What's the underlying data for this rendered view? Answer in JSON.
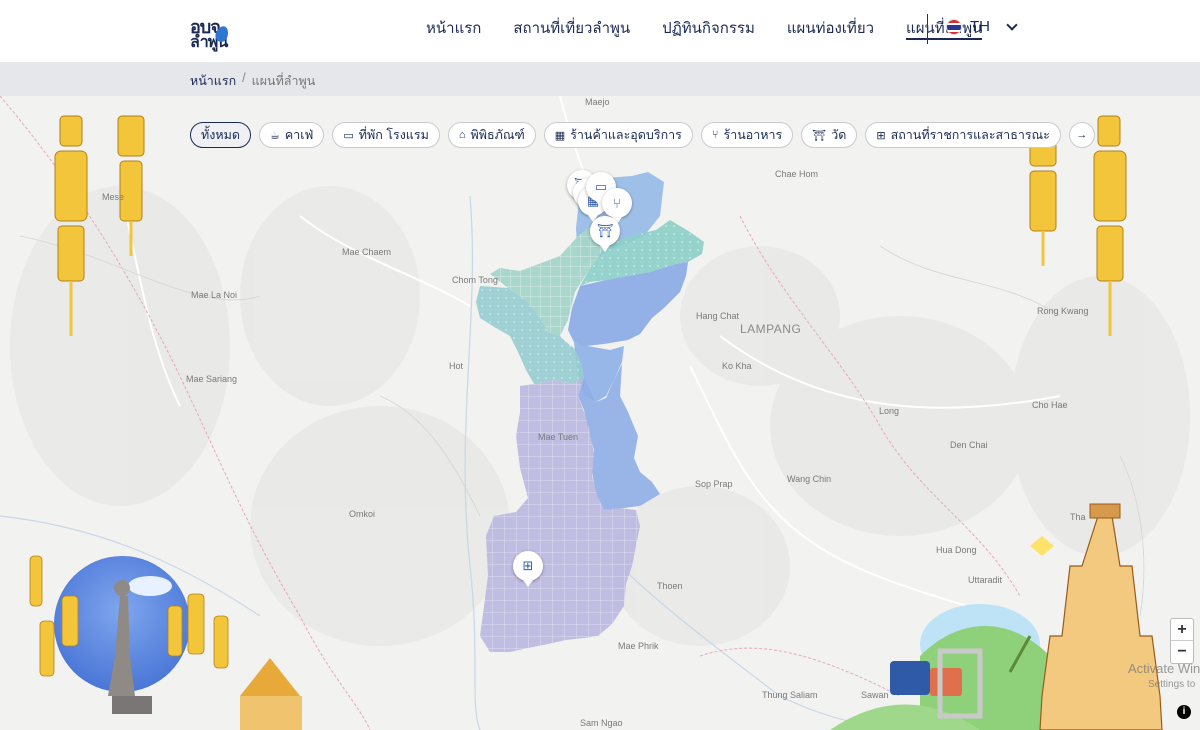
{
  "header": {
    "logo_line1": "อบจ",
    "logo_line2": "ลำพูน",
    "nav": [
      {
        "label": "หน้าแรก"
      },
      {
        "label": "สถานที่เที่ยวลำพูน"
      },
      {
        "label": "ปฏิทินกิจกรรม"
      },
      {
        "label": "แผนท่องเที่ยว"
      },
      {
        "label": "แผนที่ลำพูน",
        "active": true
      }
    ],
    "language": "TH"
  },
  "breadcrumb": {
    "home": "หน้าแรก",
    "separator": "/",
    "current": "แผนที่ลำพูน"
  },
  "filters": [
    {
      "label": "ทั้งหมด",
      "icon": "",
      "active": true
    },
    {
      "label": "คาเฟ่",
      "icon": "cafe-icon"
    },
    {
      "label": "ที่พัก โรงแรม",
      "icon": "bed-icon"
    },
    {
      "label": "พิพิธภัณฑ์",
      "icon": "museum-icon"
    },
    {
      "label": "ร้านค้าและอุดบริการ",
      "icon": "shop-icon"
    },
    {
      "label": "ร้านอาหาร",
      "icon": "utensils-icon"
    },
    {
      "label": "วัด",
      "icon": "temple-icon"
    },
    {
      "label": "สถานที่ราชการและสาธารณะ",
      "icon": "government-icon"
    }
  ],
  "map": {
    "places": [
      {
        "name": "Maejo"
      },
      {
        "name": "Mese"
      },
      {
        "name": "Chae Hom"
      },
      {
        "name": "Mae Chaem"
      },
      {
        "name": "Chom Tong"
      },
      {
        "name": "Mae La Noi"
      },
      {
        "name": "Hang Chat"
      },
      {
        "name": "LAMPANG",
        "big": true
      },
      {
        "name": "Rong Kwang"
      },
      {
        "name": "Hot"
      },
      {
        "name": "Ko Kha"
      },
      {
        "name": "Mae Sariang"
      },
      {
        "name": "Long"
      },
      {
        "name": "Cho Hae"
      },
      {
        "name": "Mae Tuen"
      },
      {
        "name": "Den Chai"
      },
      {
        "name": "Sop Prap"
      },
      {
        "name": "Wang Chin"
      },
      {
        "name": "Omkoi"
      },
      {
        "name": "Tha"
      },
      {
        "name": "Hua Dong"
      },
      {
        "name": "Uttaradit"
      },
      {
        "name": "Thoen"
      },
      {
        "name": "Mae Phrik"
      },
      {
        "name": "Thung Saliam"
      },
      {
        "name": "Sawan"
      },
      {
        "name": "Sam Ngao"
      }
    ],
    "zoom_in": "+",
    "zoom_out": "−",
    "info": "i",
    "watermark_line1": "Activate Win",
    "watermark_line2": "Settings to"
  }
}
